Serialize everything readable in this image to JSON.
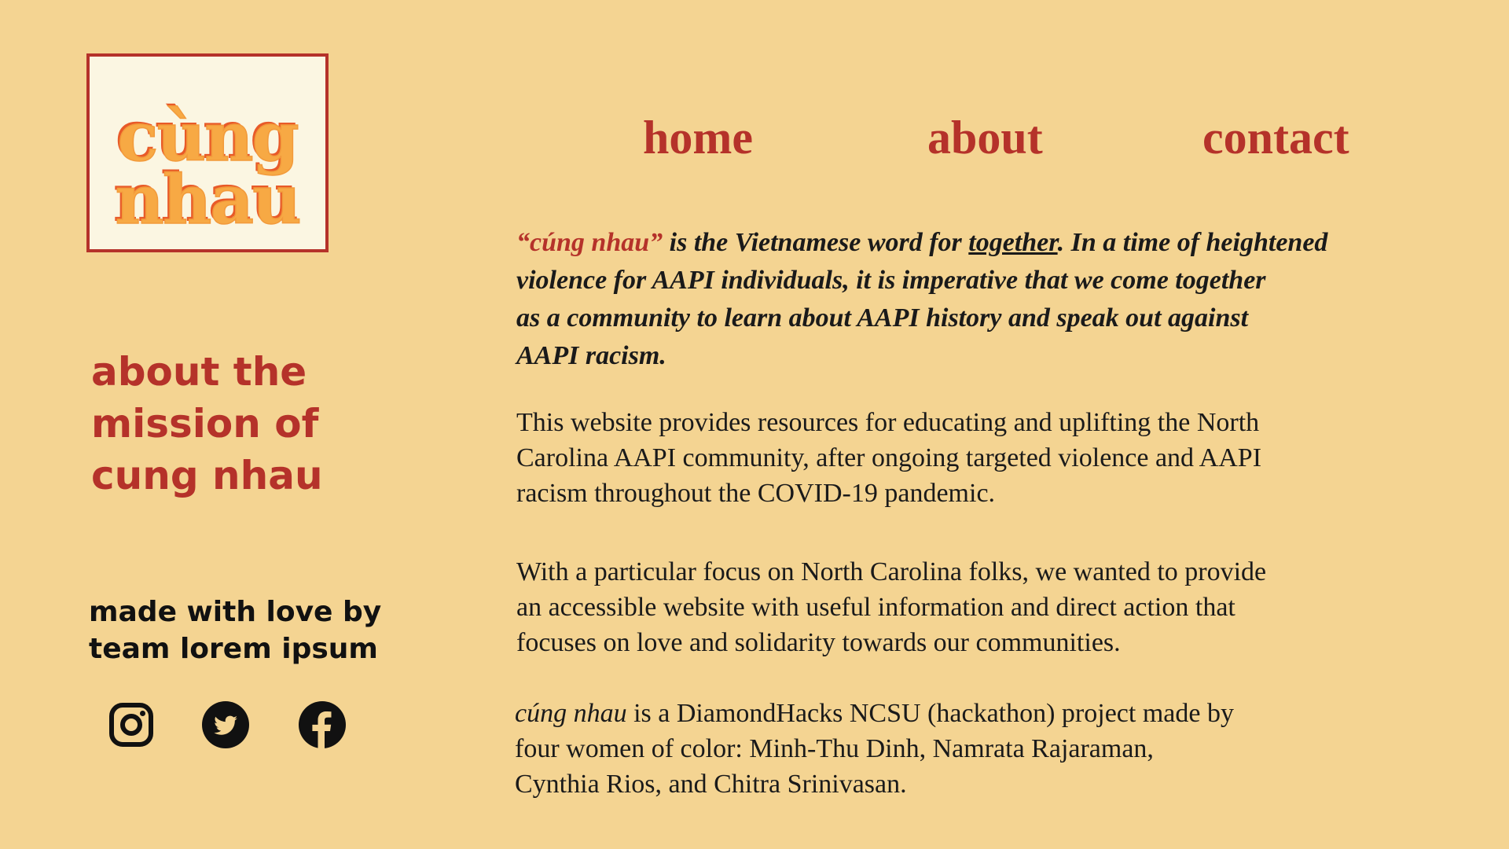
{
  "logo": {
    "line1": "cùng",
    "line2": "nhau"
  },
  "nav": {
    "home": "home",
    "about": "about",
    "contact": "contact"
  },
  "sidebar": {
    "mission_heading": [
      "about the",
      "mission of",
      "cung nhau"
    ],
    "credits": [
      "made with love by",
      "team lorem ipsum"
    ],
    "social": [
      "instagram-icon",
      "twitter-icon",
      "facebook-icon"
    ]
  },
  "colors": {
    "background": "#F4D492",
    "accent": "#B5322A",
    "logo_fill": "#F7A944",
    "logo_bg": "#FBF6E2"
  },
  "content": {
    "intro": {
      "quoted_word": "“cúng nhau”",
      "line1_a": " is the Vietnamese word for ",
      "line1_underlined": "together",
      "line1_b": ". In a time of heightened",
      "line2": "violence for AAPI individuals, it is imperative that we come together",
      "line3": "as a community to learn about AAPI history and speak out against",
      "line4": "AAPI racism."
    },
    "p2": [
      "This website provides resources for educating and uplifting the North",
      "Carolina AAPI community, after ongoing targeted violence and AAPI",
      "racism throughout the COVID-19 pandemic."
    ],
    "p3": [
      "With a particular focus on North Carolina folks, we wanted to provide",
      "an accessible website with useful information and direct action that",
      "focuses on love and solidarity towards our communities."
    ],
    "p4": {
      "name": "cúng nhau",
      "line1_rest": " is a DiamondHacks NCSU (hackathon) project made by",
      "line2": "four women of color: Minh-Thu Dinh, Namrata Rajaraman,",
      "line3": "Cynthia Rios, and Chitra Srinivasan."
    }
  }
}
